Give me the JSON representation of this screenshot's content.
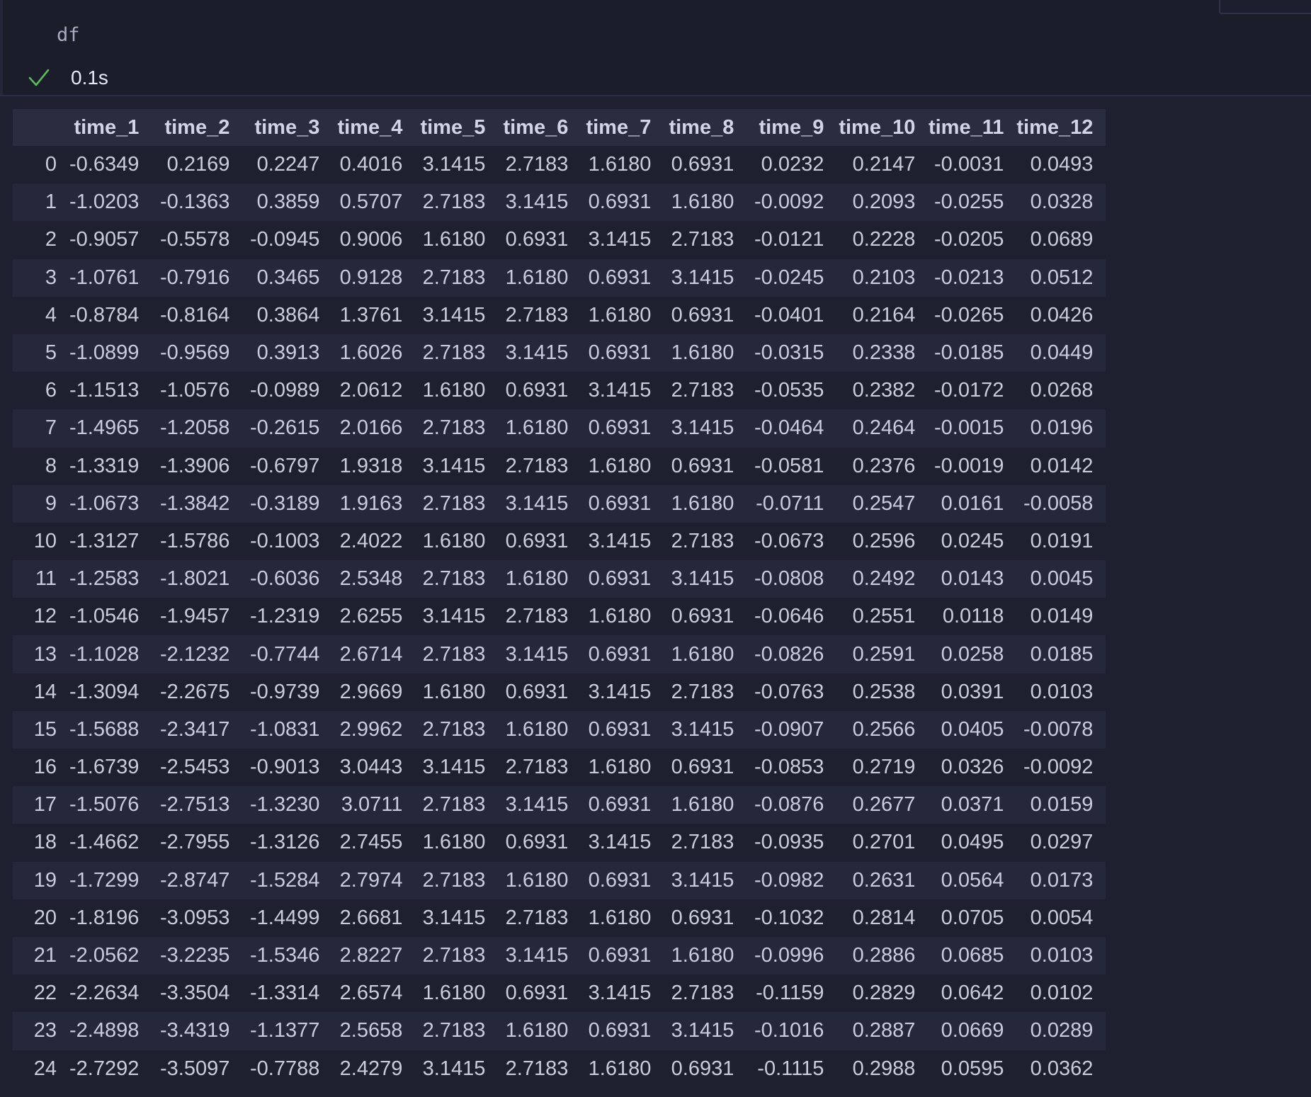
{
  "cell": {
    "code": "df",
    "execution_time": "0.1s",
    "status_icon": "check-icon"
  },
  "table": {
    "index_header": "",
    "columns": [
      "time_1",
      "time_2",
      "time_3",
      "time_4",
      "time_5",
      "time_6",
      "time_7",
      "time_8",
      "time_9",
      "time_10",
      "time_11",
      "time_12"
    ],
    "rows": [
      {
        "index": "0",
        "values": [
          "-0.6349",
          "0.2169",
          "0.2247",
          "0.4016",
          "3.1415",
          "2.7183",
          "1.6180",
          "0.6931",
          "0.0232",
          "0.2147",
          "-0.0031",
          "0.0493"
        ]
      },
      {
        "index": "1",
        "values": [
          "-1.0203",
          "-0.1363",
          "0.3859",
          "0.5707",
          "2.7183",
          "3.1415",
          "0.6931",
          "1.6180",
          "-0.0092",
          "0.2093",
          "-0.0255",
          "0.0328"
        ]
      },
      {
        "index": "2",
        "values": [
          "-0.9057",
          "-0.5578",
          "-0.0945",
          "0.9006",
          "1.6180",
          "0.6931",
          "3.1415",
          "2.7183",
          "-0.0121",
          "0.2228",
          "-0.0205",
          "0.0689"
        ]
      },
      {
        "index": "3",
        "values": [
          "-1.0761",
          "-0.7916",
          "0.3465",
          "0.9128",
          "2.7183",
          "1.6180",
          "0.6931",
          "3.1415",
          "-0.0245",
          "0.2103",
          "-0.0213",
          "0.0512"
        ]
      },
      {
        "index": "4",
        "values": [
          "-0.8784",
          "-0.8164",
          "0.3864",
          "1.3761",
          "3.1415",
          "2.7183",
          "1.6180",
          "0.6931",
          "-0.0401",
          "0.2164",
          "-0.0265",
          "0.0426"
        ]
      },
      {
        "index": "5",
        "values": [
          "-1.0899",
          "-0.9569",
          "0.3913",
          "1.6026",
          "2.7183",
          "3.1415",
          "0.6931",
          "1.6180",
          "-0.0315",
          "0.2338",
          "-0.0185",
          "0.0449"
        ]
      },
      {
        "index": "6",
        "values": [
          "-1.1513",
          "-1.0576",
          "-0.0989",
          "2.0612",
          "1.6180",
          "0.6931",
          "3.1415",
          "2.7183",
          "-0.0535",
          "0.2382",
          "-0.0172",
          "0.0268"
        ]
      },
      {
        "index": "7",
        "values": [
          "-1.4965",
          "-1.2058",
          "-0.2615",
          "2.0166",
          "2.7183",
          "1.6180",
          "0.6931",
          "3.1415",
          "-0.0464",
          "0.2464",
          "-0.0015",
          "0.0196"
        ]
      },
      {
        "index": "8",
        "values": [
          "-1.3319",
          "-1.3906",
          "-0.6797",
          "1.9318",
          "3.1415",
          "2.7183",
          "1.6180",
          "0.6931",
          "-0.0581",
          "0.2376",
          "-0.0019",
          "0.0142"
        ]
      },
      {
        "index": "9",
        "values": [
          "-1.0673",
          "-1.3842",
          "-0.3189",
          "1.9163",
          "2.7183",
          "3.1415",
          "0.6931",
          "1.6180",
          "-0.0711",
          "0.2547",
          "0.0161",
          "-0.0058"
        ]
      },
      {
        "index": "10",
        "values": [
          "-1.3127",
          "-1.5786",
          "-0.1003",
          "2.4022",
          "1.6180",
          "0.6931",
          "3.1415",
          "2.7183",
          "-0.0673",
          "0.2596",
          "0.0245",
          "0.0191"
        ]
      },
      {
        "index": "11",
        "values": [
          "-1.2583",
          "-1.8021",
          "-0.6036",
          "2.5348",
          "2.7183",
          "1.6180",
          "0.6931",
          "3.1415",
          "-0.0808",
          "0.2492",
          "0.0143",
          "0.0045"
        ]
      },
      {
        "index": "12",
        "values": [
          "-1.0546",
          "-1.9457",
          "-1.2319",
          "2.6255",
          "3.1415",
          "2.7183",
          "1.6180",
          "0.6931",
          "-0.0646",
          "0.2551",
          "0.0118",
          "0.0149"
        ]
      },
      {
        "index": "13",
        "values": [
          "-1.1028",
          "-2.1232",
          "-0.7744",
          "2.6714",
          "2.7183",
          "3.1415",
          "0.6931",
          "1.6180",
          "-0.0826",
          "0.2591",
          "0.0258",
          "0.0185"
        ]
      },
      {
        "index": "14",
        "values": [
          "-1.3094",
          "-2.2675",
          "-0.9739",
          "2.9669",
          "1.6180",
          "0.6931",
          "3.1415",
          "2.7183",
          "-0.0763",
          "0.2538",
          "0.0391",
          "0.0103"
        ]
      },
      {
        "index": "15",
        "values": [
          "-1.5688",
          "-2.3417",
          "-1.0831",
          "2.9962",
          "2.7183",
          "1.6180",
          "0.6931",
          "3.1415",
          "-0.0907",
          "0.2566",
          "0.0405",
          "-0.0078"
        ]
      },
      {
        "index": "16",
        "values": [
          "-1.6739",
          "-2.5453",
          "-0.9013",
          "3.0443",
          "3.1415",
          "2.7183",
          "1.6180",
          "0.6931",
          "-0.0853",
          "0.2719",
          "0.0326",
          "-0.0092"
        ]
      },
      {
        "index": "17",
        "values": [
          "-1.5076",
          "-2.7513",
          "-1.3230",
          "3.0711",
          "2.7183",
          "3.1415",
          "0.6931",
          "1.6180",
          "-0.0876",
          "0.2677",
          "0.0371",
          "0.0159"
        ]
      },
      {
        "index": "18",
        "values": [
          "-1.4662",
          "-2.7955",
          "-1.3126",
          "2.7455",
          "1.6180",
          "0.6931",
          "3.1415",
          "2.7183",
          "-0.0935",
          "0.2701",
          "0.0495",
          "0.0297"
        ]
      },
      {
        "index": "19",
        "values": [
          "-1.7299",
          "-2.8747",
          "-1.5284",
          "2.7974",
          "2.7183",
          "1.6180",
          "0.6931",
          "3.1415",
          "-0.0982",
          "0.2631",
          "0.0564",
          "0.0173"
        ]
      },
      {
        "index": "20",
        "values": [
          "-1.8196",
          "-3.0953",
          "-1.4499",
          "2.6681",
          "3.1415",
          "2.7183",
          "1.6180",
          "0.6931",
          "-0.1032",
          "0.2814",
          "0.0705",
          "0.0054"
        ]
      },
      {
        "index": "21",
        "values": [
          "-2.0562",
          "-3.2235",
          "-1.5346",
          "2.8227",
          "2.7183",
          "3.1415",
          "0.6931",
          "1.6180",
          "-0.0996",
          "0.2886",
          "0.0685",
          "0.0103"
        ]
      },
      {
        "index": "22",
        "values": [
          "-2.2634",
          "-3.3504",
          "-1.3314",
          "2.6574",
          "1.6180",
          "0.6931",
          "3.1415",
          "2.7183",
          "-0.1159",
          "0.2829",
          "0.0642",
          "0.0102"
        ]
      },
      {
        "index": "23",
        "values": [
          "-2.4898",
          "-3.4319",
          "-1.1377",
          "2.5658",
          "2.7183",
          "1.6180",
          "0.6931",
          "3.1415",
          "-0.1016",
          "0.2887",
          "0.0669",
          "0.0289"
        ]
      },
      {
        "index": "24",
        "values": [
          "-2.7292",
          "-3.5097",
          "-0.7788",
          "2.4279",
          "3.1415",
          "2.7183",
          "1.6180",
          "0.6931",
          "-0.1115",
          "0.2988",
          "0.0595",
          "0.0362"
        ]
      }
    ]
  }
}
